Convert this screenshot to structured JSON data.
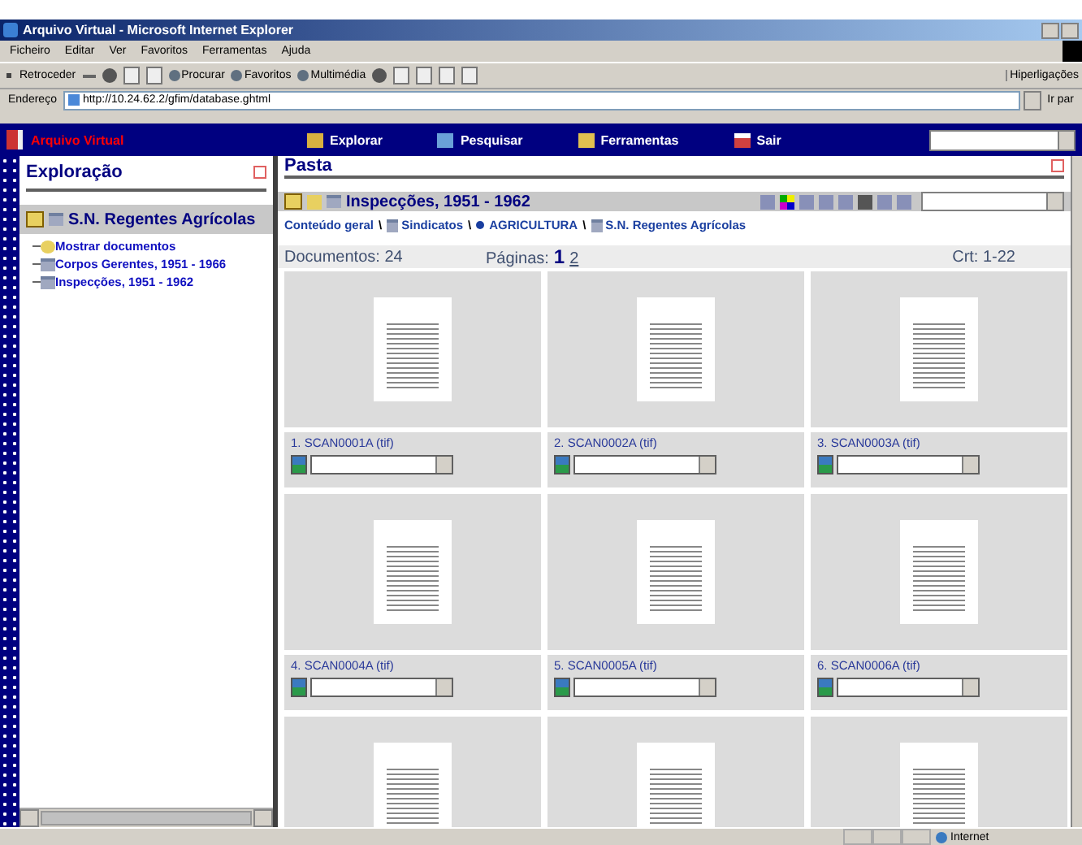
{
  "window": {
    "title": "Arquivo Virtual - Microsoft Internet Explorer"
  },
  "menu": [
    "Ficheiro",
    "Editar",
    "Ver",
    "Favoritos",
    "Ferramentas",
    "Ajuda"
  ],
  "toolbar": [
    {
      "kind": "back",
      "label": "Retroceder"
    },
    {
      "kind": "search",
      "label": "Procurar"
    },
    {
      "kind": "favorites",
      "label": "Favoritos"
    },
    {
      "kind": "media",
      "label": "Multimédia"
    }
  ],
  "links_label": "Hiperligações",
  "address": {
    "label": "Endereço",
    "value": "http://10.24.62.2/gfim/database.ghtml",
    "go": "Ir par"
  },
  "app_nav": {
    "logo": "Arquivo Virtual",
    "items": [
      "Explorar",
      "Pesquisar",
      "Ferramentas",
      "Sair"
    ]
  },
  "explorer": {
    "title": "Exploração",
    "root": {
      "label": "S.N. Regentes Agrícolas",
      "children": [
        {
          "kind": "show",
          "label": "Mostrar documentos"
        },
        {
          "kind": "folder",
          "label": "Corpos Gerentes, 1951 - 1966"
        },
        {
          "kind": "folder",
          "label": "Inspecções, 1951 - 1962"
        }
      ]
    }
  },
  "folder": {
    "title": "Pasta",
    "name": "Inspecções, 1951 - 1962",
    "breadcrumb": [
      {
        "kind": "text",
        "label": "Conteúdo geral"
      },
      {
        "kind": "folder",
        "label": "Sindicatos"
      },
      {
        "kind": "radio",
        "label": "AGRICULTURA"
      },
      {
        "kind": "folder",
        "label": "S.N. Regentes Agrícolas"
      }
    ],
    "separator": "\\",
    "documents_count": "Documentos: 24",
    "pages_label": "Páginas:",
    "pages": [
      {
        "label": "1",
        "selected": true
      },
      {
        "label": "2",
        "selected": false
      }
    ],
    "range": "Crt: 1-22",
    "documents": [
      {
        "kind": "document",
        "caption": "1. SCAN0001A (tif)"
      },
      {
        "kind": "document",
        "caption": "2. SCAN0002A (tif)"
      },
      {
        "kind": "document",
        "caption": "3. SCAN0003A (tif)"
      },
      {
        "kind": "document",
        "caption": "4. SCAN0004A (tif)"
      },
      {
        "kind": "document",
        "caption": "5. SCAN0005A (tif)"
      },
      {
        "kind": "document",
        "caption": "6. SCAN0006A (tif)"
      },
      {
        "kind": "thumbnail"
      },
      {
        "kind": "thumbnail"
      },
      {
        "kind": "thumbnail"
      }
    ]
  },
  "status_bar": {
    "zone": "Internet"
  }
}
